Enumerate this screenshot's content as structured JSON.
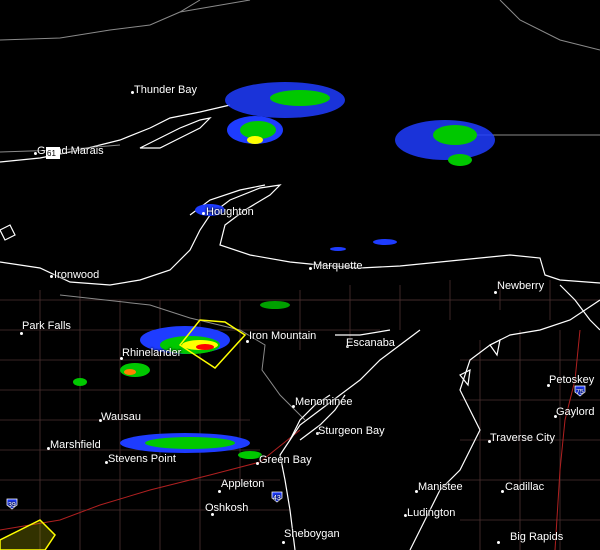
{
  "cities": [
    {
      "id": "thunder-bay",
      "name": "Thunder Bay"
    },
    {
      "id": "grand-marais",
      "name": "Grand Marais"
    },
    {
      "id": "houghton",
      "name": "Houghton"
    },
    {
      "id": "ironwood",
      "name": "Ironwood"
    },
    {
      "id": "marquette",
      "name": "Marquette"
    },
    {
      "id": "newberry",
      "name": "Newberry"
    },
    {
      "id": "park-falls",
      "name": "Park Falls"
    },
    {
      "id": "iron-mountain",
      "name": "Iron Mountain"
    },
    {
      "id": "escanaba",
      "name": "Escanaba"
    },
    {
      "id": "rhinelander",
      "name": "Rhinelander"
    },
    {
      "id": "petoskey",
      "name": "Petoskey"
    },
    {
      "id": "menominee",
      "name": "Menominee"
    },
    {
      "id": "gaylord",
      "name": "Gaylord"
    },
    {
      "id": "wausau",
      "name": "Wausau"
    },
    {
      "id": "sturgeon-bay",
      "name": "Sturgeon Bay"
    },
    {
      "id": "marshfield",
      "name": "Marshfield"
    },
    {
      "id": "traverse-city",
      "name": "Traverse City"
    },
    {
      "id": "stevens-point",
      "name": "Stevens Point"
    },
    {
      "id": "green-bay",
      "name": "Green Bay"
    },
    {
      "id": "appleton",
      "name": "Appleton"
    },
    {
      "id": "manistee",
      "name": "Manistee"
    },
    {
      "id": "cadillac",
      "name": "Cadillac"
    },
    {
      "id": "oshkosh",
      "name": "Oshkosh"
    },
    {
      "id": "ludington",
      "name": "Ludington"
    },
    {
      "id": "sheboygan",
      "name": "Sheboygan"
    },
    {
      "id": "big-rapids",
      "name": "Big Rapids"
    }
  ],
  "highway_shields": [
    {
      "id": "hwy-61",
      "label": "61"
    },
    {
      "id": "hwy-75",
      "label": "75"
    },
    {
      "id": "hwy-43",
      "label": "43"
    },
    {
      "id": "hwy-39",
      "label": "39"
    }
  ],
  "colors": {
    "background": "#000000",
    "coastline": "#ffffff",
    "state_border": "#8a8a8a",
    "county_lines": "#5a3a3a",
    "warning_polygon": "#ffff00",
    "radar_light": "#1e3cff",
    "radar_mid": "#00c800",
    "radar_heavy": "#ffff00",
    "radar_severe": "#ff0000"
  }
}
